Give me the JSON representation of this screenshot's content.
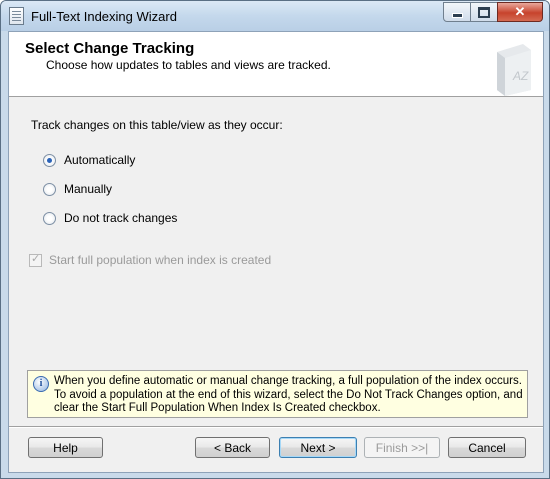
{
  "window": {
    "title": "Full-Text Indexing Wizard",
    "close_glyph": "✕"
  },
  "header": {
    "title": "Select Change Tracking",
    "subtitle": "Choose how updates to tables and views are tracked."
  },
  "tracking": {
    "prompt": "Track changes on this table/view as they occur:",
    "options": [
      {
        "label": "Automatically",
        "selected": true
      },
      {
        "label": "Manually",
        "selected": false
      },
      {
        "label": "Do not track changes",
        "selected": false
      }
    ]
  },
  "start_population": {
    "label": "Start full population when index is created",
    "checked": true,
    "enabled": false
  },
  "info": {
    "icon": "info-icon",
    "text": "When you define automatic or manual change tracking, a full population of the index occurs. To avoid a population at the end of this wizard, select the Do Not Track Changes option, and clear the Start Full Population When Index Is Created checkbox."
  },
  "buttons": {
    "help": "Help",
    "back": "< Back",
    "next": "Next >",
    "finish": "Finish >>|",
    "cancel": "Cancel"
  },
  "colors": {
    "titlebar": "#c4d8ec",
    "accent": "#2b63b8",
    "info_bg": "#ffffe1"
  }
}
